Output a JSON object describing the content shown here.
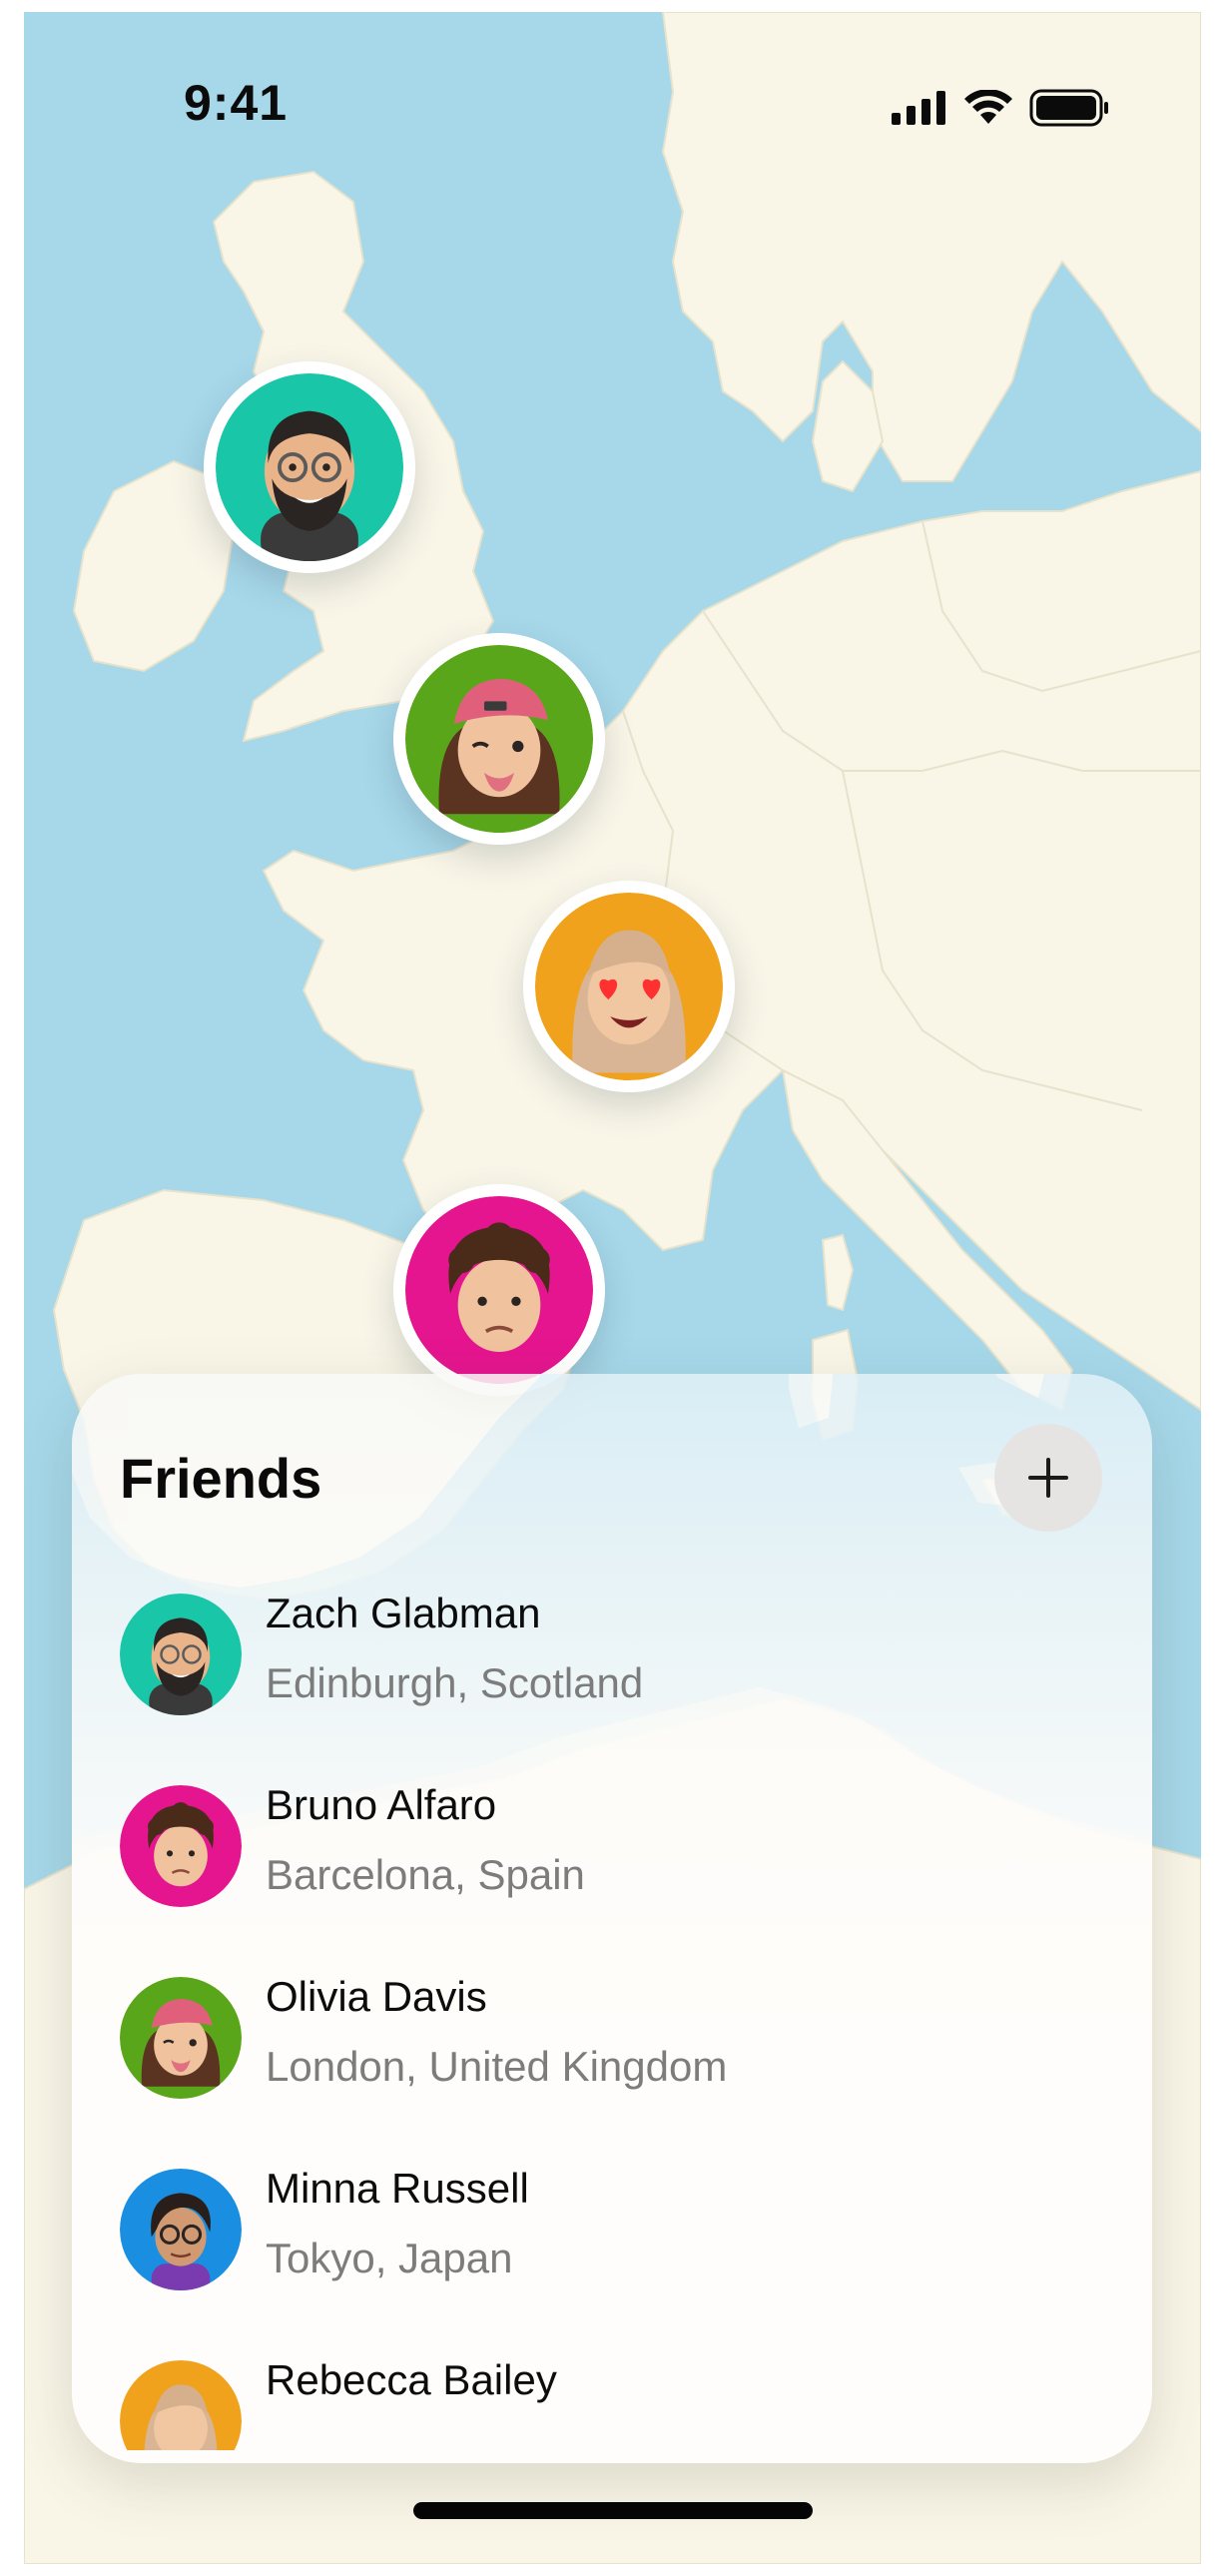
{
  "status_bar": {
    "time": "9:41",
    "icons": [
      "cellular-signal-icon",
      "wifi-icon",
      "battery-icon"
    ]
  },
  "map": {
    "water_color": "#a6d8ea",
    "land_color": "#f9f6e8",
    "pins": [
      {
        "name": "Zach Glabman",
        "ring_color": "#19c6a8"
      },
      {
        "name": "Olivia Davis",
        "ring_color": "#5aa61a"
      },
      {
        "name": "Rebecca Bailey",
        "ring_color": "#f0a21c"
      },
      {
        "name": "Bruno Alfaro",
        "ring_color": "#e5158f"
      }
    ]
  },
  "friends_sheet": {
    "title": "Friends",
    "add_icon": "plus-icon",
    "friends": [
      {
        "name": "Zach Glabman",
        "location": "Edinburgh, Scotland",
        "avatar_color": "#19c6a8"
      },
      {
        "name": "Bruno Alfaro",
        "location": "Barcelona, Spain",
        "avatar_color": "#e5158f"
      },
      {
        "name": "Olivia Davis",
        "location": "London, United Kingdom",
        "avatar_color": "#5aa61a"
      },
      {
        "name": "Minna Russell",
        "location": "Tokyo, Japan",
        "avatar_color": "#1a8ee0"
      },
      {
        "name": "Rebecca Bailey",
        "location": "",
        "avatar_color": "#f0a21c"
      }
    ]
  }
}
